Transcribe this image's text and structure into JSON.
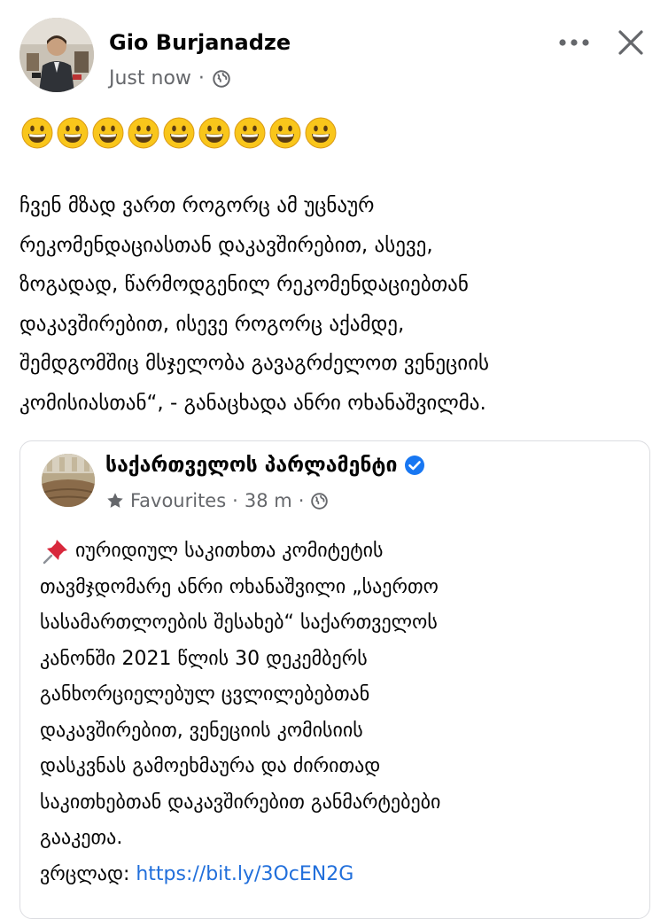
{
  "post": {
    "author": "Gio Burjanadze",
    "time": "Just now",
    "emoji_count": 9,
    "text": "ჩვენ მზად ვართ როგორც ამ უცნაურ\nრეკომენდაციასთან დაკავშირებით, ასევე,\nზოგადად, წარმოდგენილ რეკომენდაციებთან\nდაკავშირებით, ისევე როგორც აქამდე,\nშემდგომშიც მსჯელობა გავაგრძელოთ ვენეციის\nკომისიასთან“, - განაცხადა ანრი ოხანაშვილმა."
  },
  "shared": {
    "page_name": "საქართველოს პარლამენტი",
    "favourites": "Favourites",
    "time": "38 m",
    "text": "იურიდიულ საკითხთა კომიტეტის\nთავმჯდომარე ანრი ოხანაშვილი „საერთო\nსასამართლოების შესახებ“ საქართველოს\nკანონში 2021 წლის 30 დეკემბერს\nგანხორციელებულ ცვლილებებთან\nდაკავშირებით, ვენეციის კომისიის\nდასკვნას გამოეხმაურა და ძირითად\nსაკითხებთან დაკავშირებით განმარტებები\nგააკეთა.",
    "link_prefix": "ვრცლად:",
    "link": "https://bit.ly/3OcEN2G"
  },
  "icons": [
    "globe-icon",
    "more-icon",
    "close-icon",
    "grinning-face-emoji",
    "verified-badge-icon",
    "star-icon",
    "pushpin-icon"
  ],
  "colors": {
    "meta": "#65676b",
    "link": "#216fdb",
    "verified": "#1877f2",
    "border": "#dcdde1"
  }
}
